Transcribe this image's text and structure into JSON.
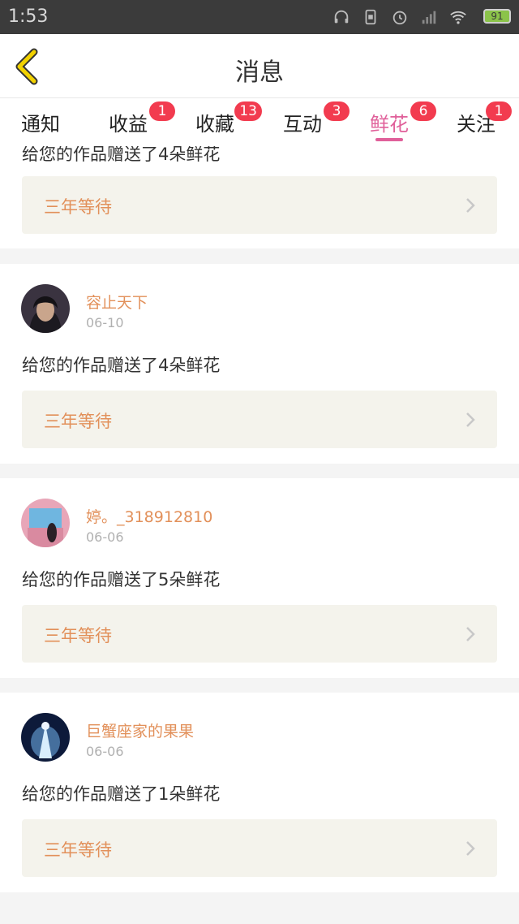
{
  "status_bar": {
    "time": "1:53",
    "battery": "91",
    "icons": [
      "headphones-icon",
      "dual-sim-icon",
      "alarm-icon",
      "signal-icon",
      "wifi-icon",
      "battery-icon"
    ]
  },
  "header": {
    "title": "消息",
    "back_icon": "chevron-left-icon",
    "accent": "#e8c200"
  },
  "tabs": [
    {
      "label": "通知",
      "badge": ""
    },
    {
      "label": "收益",
      "badge": "1"
    },
    {
      "label": "收藏",
      "badge": "13"
    },
    {
      "label": "互动",
      "badge": "3"
    },
    {
      "label": "鲜花",
      "badge": "6",
      "active": true
    },
    {
      "label": "关注",
      "badge": "1"
    }
  ],
  "colors": {
    "active_tab": "#e0609a",
    "badge": "#f23b4f",
    "name": "#e2905a",
    "work_bg": "#f4f3ec"
  },
  "partial_card": {
    "message": "给您的作品赠送了4朵鲜花",
    "work_title": "三年等待"
  },
  "messages": [
    {
      "user": "容止天下",
      "date": "06-10",
      "message": "给您的作品赠送了4朵鲜花",
      "work_title": "三年等待"
    },
    {
      "user": "婷。_318912810",
      "date": "06-06",
      "message": "给您的作品赠送了5朵鲜花",
      "work_title": "三年等待"
    },
    {
      "user": "巨蟹座家的果果",
      "date": "06-06",
      "message": "给您的作品赠送了1朵鲜花",
      "work_title": "三年等待"
    }
  ]
}
